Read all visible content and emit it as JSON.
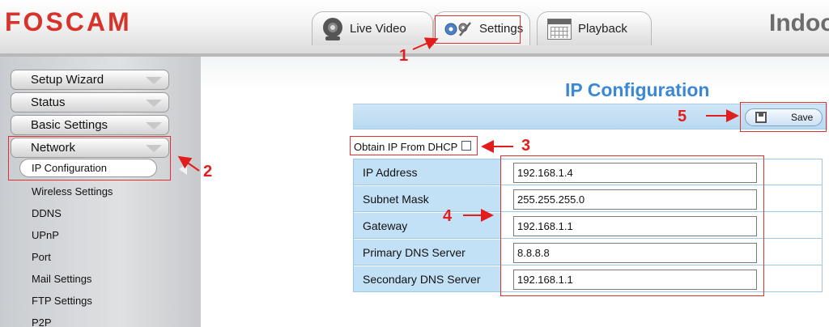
{
  "header": {
    "logo": "FOSCAM",
    "device_name": "Indoo",
    "tabs": [
      {
        "label": "Live Video",
        "icon": "webcam-icon"
      },
      {
        "label": "Settings",
        "icon": "gears-icon"
      },
      {
        "label": "Playback",
        "icon": "calendar-icon"
      }
    ]
  },
  "sidebar": {
    "menus": [
      {
        "label": "Setup Wizard"
      },
      {
        "label": "Status"
      },
      {
        "label": "Basic Settings"
      },
      {
        "label": "Network"
      }
    ],
    "network_items": [
      {
        "label": "IP Configuration",
        "active": true
      },
      {
        "label": "Wireless Settings"
      },
      {
        "label": "DDNS"
      },
      {
        "label": "UPnP"
      },
      {
        "label": "Port"
      },
      {
        "label": "Mail Settings"
      },
      {
        "label": "FTP Settings"
      },
      {
        "label": "P2P"
      }
    ]
  },
  "main": {
    "title": "IP Configuration",
    "save_label": "Save",
    "dhcp_label": "Obtain IP From DHCP",
    "dhcp_checked": false,
    "rows": [
      {
        "label": "IP Address",
        "value": "192.168.1.4"
      },
      {
        "label": "Subnet Mask",
        "value": "255.255.255.0"
      },
      {
        "label": "Gateway",
        "value": "192.168.1.1"
      },
      {
        "label": "Primary DNS Server",
        "value": "8.8.8.8"
      },
      {
        "label": "Secondary DNS Server",
        "value": "192.168.1.1"
      }
    ]
  },
  "annotations": [
    "1",
    "2",
    "3",
    "4",
    "5"
  ],
  "colors": {
    "logo": "#d8332a",
    "title": "#3b88d8",
    "annotation": "#e21d1d",
    "table_label_bg": "#c3e1f6"
  }
}
